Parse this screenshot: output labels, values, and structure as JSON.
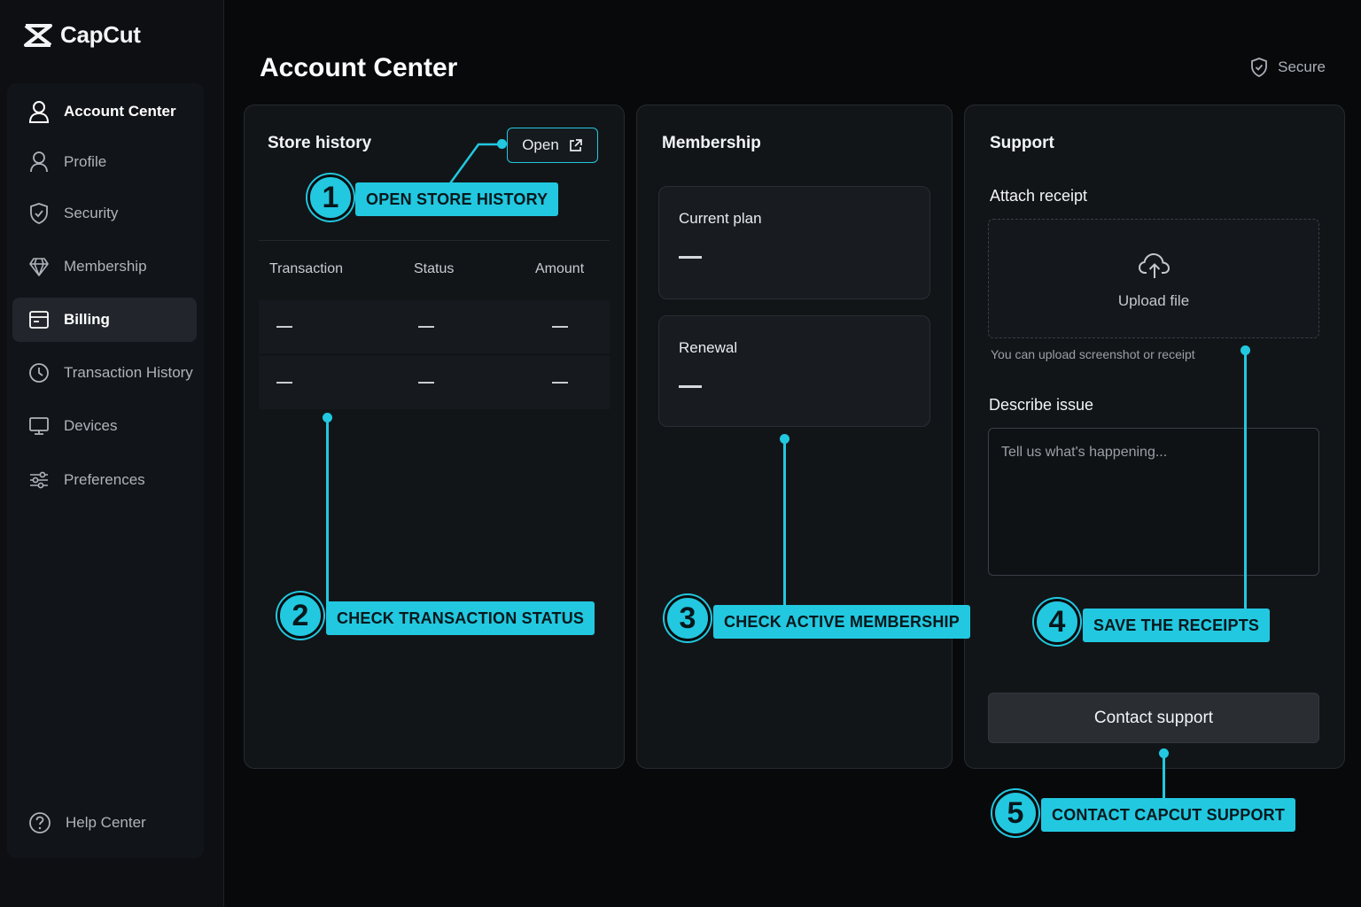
{
  "app": {
    "brand": "CapCut",
    "accent_color": "#22c8e0"
  },
  "sidebar": {
    "items": [
      {
        "label": "Account Center",
        "icon": "user-icon"
      },
      {
        "label": "Profile",
        "icon": "user-icon"
      },
      {
        "label": "Security",
        "icon": "shield-icon"
      },
      {
        "label": "Membership",
        "icon": "diamond-icon"
      },
      {
        "label": "Billing",
        "icon": "billing-icon",
        "selected": true
      },
      {
        "label": "Transaction History",
        "icon": "clock-icon"
      },
      {
        "label": "Devices",
        "icon": "monitor-icon"
      },
      {
        "label": "Preferences",
        "icon": "sliders-icon"
      }
    ],
    "help": {
      "label": "Help Center",
      "icon": "help-icon"
    }
  },
  "header": {
    "title": "Account Center",
    "secure_label": "Secure"
  },
  "store_history": {
    "title": "Store history",
    "open_label": "Open",
    "columns": [
      "Transaction",
      "Status",
      "Amount"
    ],
    "rows": [
      [
        "—",
        "—",
        "—"
      ],
      [
        "—",
        "—",
        "—"
      ]
    ]
  },
  "membership": {
    "title": "Membership",
    "current_plan_label": "Current plan",
    "current_plan_value": "—",
    "renewal_label": "Renewal",
    "renewal_value": "—"
  },
  "support": {
    "title": "Support",
    "attach_label": "Attach receipt",
    "upload_label": "Upload file",
    "upload_hint": "You can upload screenshot or receipt",
    "describe_label": "Describe issue",
    "describe_placeholder": "Tell us what's happening...",
    "contact_label": "Contact support"
  },
  "callouts": [
    {
      "number": "1",
      "text": "OPEN STORE HISTORY"
    },
    {
      "number": "2",
      "text": "CHECK TRANSACTION STATUS"
    },
    {
      "number": "3",
      "text": "CHECK ACTIVE MEMBERSHIP"
    },
    {
      "number": "4",
      "text": "SAVE THE RECEIPTS"
    },
    {
      "number": "5",
      "text": "CONTACT CAPCUT SUPPORT"
    }
  ]
}
